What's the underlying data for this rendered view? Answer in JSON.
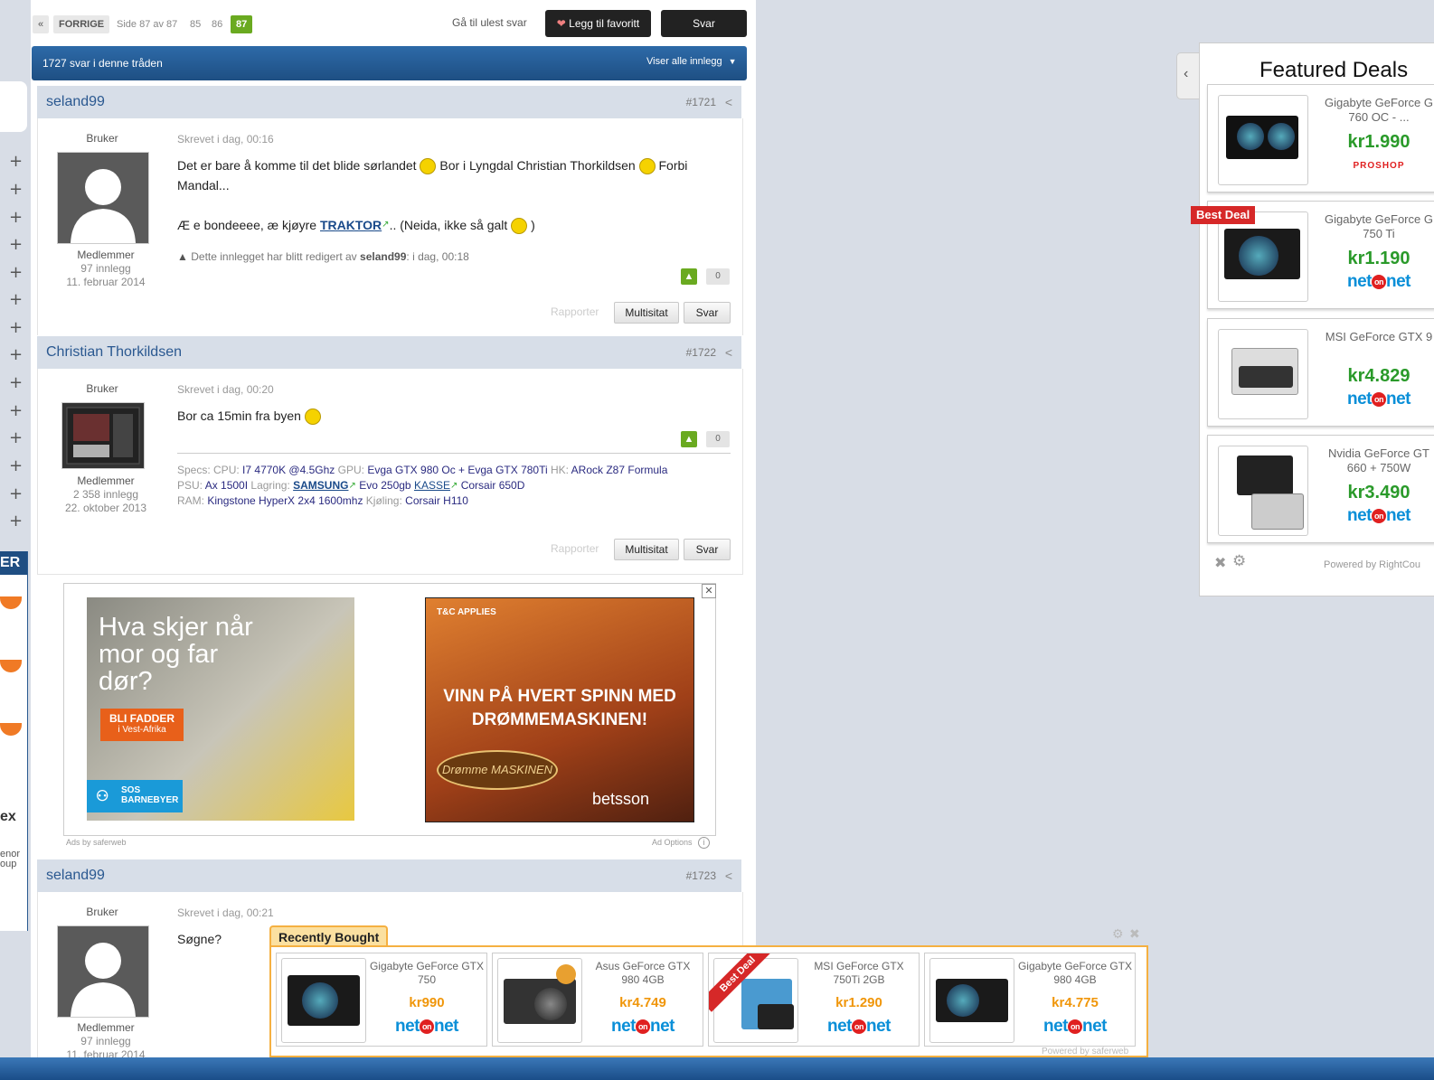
{
  "nav": {
    "first": "«",
    "prev": "FORRIGE",
    "page_info": "Side 87 av 87",
    "pages": [
      "85",
      "86"
    ],
    "current": "87",
    "unread": "Gå til ulest svar",
    "fav": "Legg til favoritt",
    "reply": "Svar"
  },
  "thread": {
    "count": "1727 svar i denne tråden",
    "view_all": "Viser alle innlegg"
  },
  "posts": [
    {
      "author": "seland99",
      "num": "#1721",
      "role": "Bruker",
      "group": "Medlemmer",
      "count": "97 innlegg",
      "joined": "11. februar 2014",
      "written": "Skrevet i dag, 00:16",
      "line1a": "Det er bare å komme til det blide sørlandet",
      "line1b": "Bor i Lyngdal Christian Thorkildsen",
      "line1c": "Forbi",
      "line2": "Mandal...",
      "line3a": "Æ e bondeeee, æ kjøyre",
      "line3link": "TRAKTOR",
      "line3b": ".. (Neida, ikke så galt",
      "line3c": ")",
      "edit_pre": "Dette innlegget har blitt redigert av",
      "edit_user": "seland99",
      "edit_post": ": i dag, 00:18",
      "votes": "0",
      "report": "Rapporter",
      "multi": "Multisitat",
      "reply": "Svar"
    },
    {
      "author": "Christian Thorkildsen",
      "num": "#1722",
      "role": "Bruker",
      "group": "Medlemmer",
      "count": "2 358 innlegg",
      "joined": "22. oktober 2013",
      "written": "Skrevet i dag, 00:20",
      "text": "Bor ca 15min fra byen",
      "votes": "0",
      "specs": {
        "l_specs": "Specs: CPU:",
        "cpu": "I7 4770K @4.5Ghz",
        "l_gpu": "GPU:",
        "gpu": "Evga GTX 980 Oc + Evga GTX 780Ti",
        "l_hk": "HK:",
        "hk": "ARock Z87 Formula",
        "l_psu": "PSU:",
        "psu": "Ax 1500I",
        "l_storage": "Lagring:",
        "samsung": "SAMSUNG",
        "evo": "Evo 250gb",
        "kasse": "KASSE",
        "case": "Corsair 650D",
        "l_ram": "RAM:",
        "ram": "Kingstone HyperX 2x4 1600mhz",
        "l_cool": "Kjøling:",
        "cool": "Corsair H110"
      },
      "report": "Rapporter",
      "multi": "Multisitat",
      "reply": "Svar"
    },
    {
      "author": "seland99",
      "num": "#1723",
      "role": "Bruker",
      "group": "Medlemmer",
      "count": "97 innlegg",
      "joined": "11. februar 2014",
      "written": "Skrevet i dag, 00:21",
      "text": "Søgne?"
    }
  ],
  "ads": {
    "left_title": "Hva skjer når mor og far dør?",
    "left_cta": "BLI FADDER",
    "left_cta_sub": "i Vest-Afrika",
    "left_brand": "SOS BARNEBYER",
    "right_tc": "T&C APPLIES",
    "right_title": "VINN PÅ HVERT SPINN MED DRØMMEMASKINEN!",
    "right_logo": "Drømme MASKINEN",
    "right_brand": "betsson",
    "ads_by": "Ads by saferweb",
    "ad_options": "Ad Options"
  },
  "featured": {
    "title": "Featured Deals",
    "badge": "Best Deal",
    "items": [
      {
        "name1": "Gigabyte GeForce G",
        "name2": "760 OC - ...",
        "price": "kr1.990",
        "store": "PROSHOP"
      },
      {
        "name1": "Gigabyte GeForce G",
        "name2": "750 Ti",
        "price": "kr1.190",
        "store": "netonnet"
      },
      {
        "name1": "MSI GeForce GTX 9",
        "name2": "",
        "price": "kr4.829",
        "store": "netonnet"
      },
      {
        "name1": "Nvidia GeForce GT",
        "name2": "660 + 750W",
        "price": "kr3.490",
        "store": "netonnet"
      }
    ],
    "powered": "Powered by RightCou"
  },
  "recent": {
    "title": "Recently Bought",
    "badge": "Best Deal",
    "items": [
      {
        "name1": "Gigabyte GeForce GTX",
        "name2": "750",
        "price": "kr990"
      },
      {
        "name1": "Asus GeForce GTX",
        "name2": "980 4GB",
        "price": "kr4.749"
      },
      {
        "name1": "MSI GeForce GTX",
        "name2": "750Ti 2GB",
        "price": "kr1.290"
      },
      {
        "name1": "Gigabyte GeForce GTX",
        "name2": "980 4GB",
        "price": "kr4.775"
      }
    ],
    "store": {
      "a": "net",
      "b": "on",
      "c": "net"
    },
    "powered": "Powered by saferweb"
  },
  "left": {
    "er_label": "ER",
    "brand1": "ex",
    "brand2a": "enor",
    "brand2b": "oup"
  },
  "colors": {
    "accent": "#2d6aa8",
    "vote": "#6aaa20",
    "price_green": "#2a9a2a",
    "price_orange": "#f0960a",
    "netonnet_blue": "#0a8fd8",
    "best_deal_red": "#d62828"
  }
}
